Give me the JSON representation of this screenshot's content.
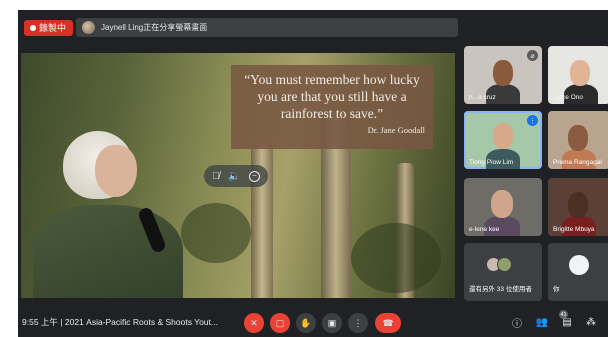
{
  "topbar": {
    "recording_label": "錄製中",
    "share_text": "Jaynell Ling正在分享螢幕畫面"
  },
  "presentation": {
    "quote_text": "“You must remember how lucky you are that you still have a rainforest to save.”",
    "quote_author": "Dr. Jane Goodall"
  },
  "participants": [
    {
      "name": "n...o cruz"
    },
    {
      "name": "...nce Ono"
    },
    {
      "name": "Tiong Piow Lim"
    },
    {
      "name": "Prema Rangagal"
    },
    {
      "name": "e-lene kee"
    },
    {
      "name": "Brigitte Mbuya"
    }
  ],
  "others_tile": {
    "label": "還有另外 33 位使用者"
  },
  "self_tile": {
    "label": "你"
  },
  "bottombar": {
    "time": "9:55 上午",
    "separator": "|",
    "meeting_title": "2021 Asia-Pacific Roots & Shoots Yout...",
    "participant_badge": "41"
  },
  "icons": {
    "mic_off": "mic-off-icon",
    "cam_off": "camera-off-icon",
    "raise_hand": "raise-hand-icon",
    "present": "present-screen-icon",
    "more": "more-options-icon",
    "end_call": "end-call-icon",
    "info": "info-icon",
    "people": "people-icon",
    "chat": "chat-icon",
    "activities": "activities-icon"
  },
  "colors": {
    "record_red": "#d93025",
    "end_red": "#ea4335",
    "active_blue": "#8ab4f8",
    "bg": "#202124"
  }
}
